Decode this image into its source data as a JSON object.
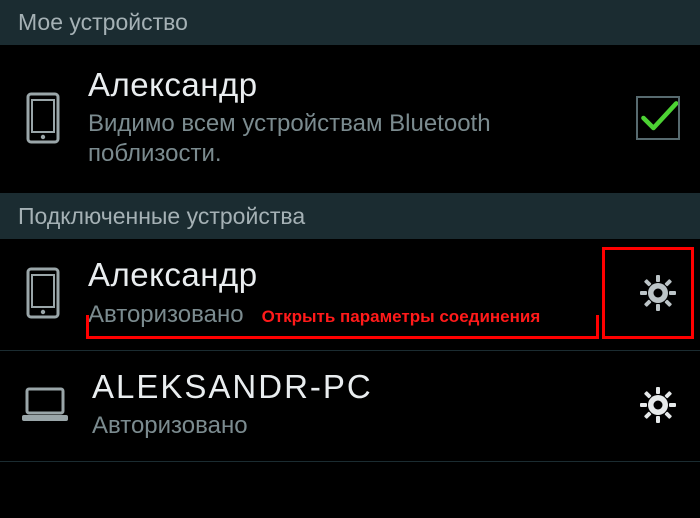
{
  "sections": {
    "my_device": {
      "header": "Мое устройство",
      "item": {
        "name": "Александр",
        "status": "Видимо всем устройствам Bluetooth поблизости.",
        "visible": true
      }
    },
    "paired": {
      "header": "Подключенные устройства",
      "items": [
        {
          "name": "Александр",
          "status": "Авторизовано",
          "type": "phone"
        },
        {
          "name": "ALEKSANDR-PC",
          "status": "Авторизовано",
          "type": "laptop"
        }
      ]
    }
  },
  "annotation": "Открыть параметры соединения"
}
